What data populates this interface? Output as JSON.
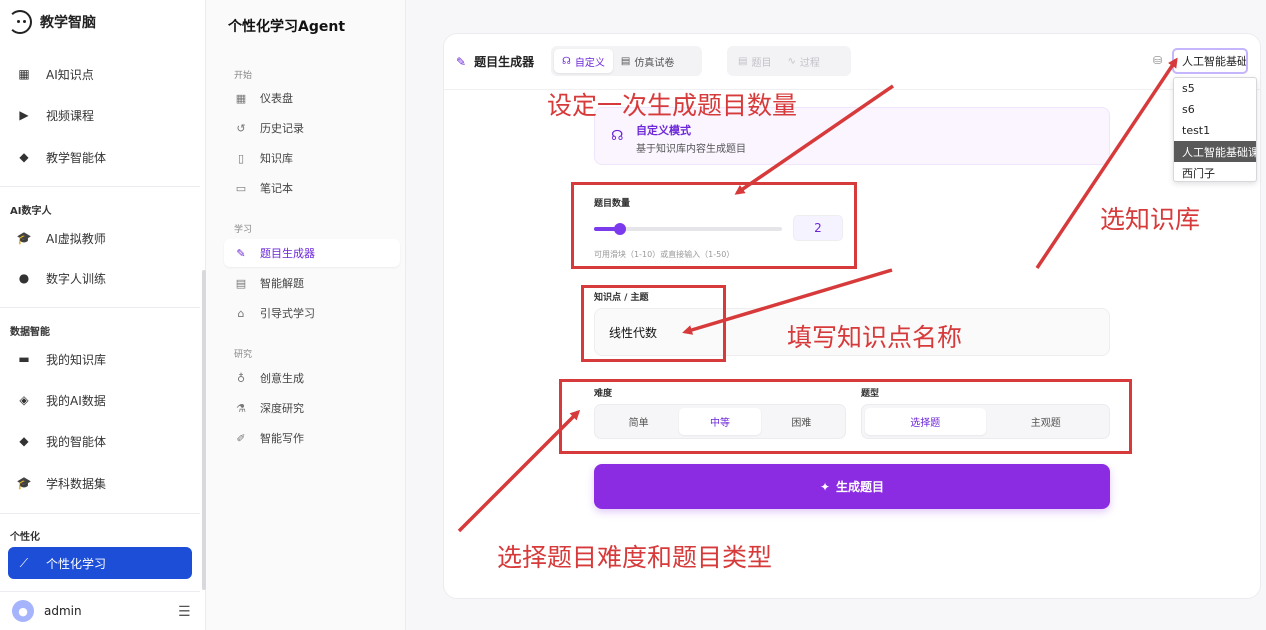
{
  "app": {
    "name": "教学智脑"
  },
  "sidebar": {
    "items_top": [
      {
        "label": "AI知识点",
        "icon": "film-icon"
      },
      {
        "label": "视频课程",
        "icon": "play-icon"
      },
      {
        "label": "教学智能体",
        "icon": "cube-icon"
      }
    ],
    "section_digital": "AI数字人",
    "items_digital": [
      {
        "label": "AI虚拟教师",
        "icon": "graduation-cap-icon"
      },
      {
        "label": "数字人训练",
        "icon": "person-icon"
      }
    ],
    "section_data": "数据智能",
    "items_data": [
      {
        "label": "我的知识库",
        "icon": "book-icon"
      },
      {
        "label": "我的AI数据",
        "icon": "box-icon"
      },
      {
        "label": "我的智能体",
        "icon": "cube-icon"
      },
      {
        "label": "学科数据集",
        "icon": "graduation-cap-icon"
      }
    ],
    "section_personal": "个性化",
    "active_item": {
      "label": "个性化学习",
      "icon": "wand-icon"
    },
    "user": "admin"
  },
  "panel2": {
    "title": "个性化学习Agent",
    "section_start": "开始",
    "items_start": [
      "仪表盘",
      "历史记录",
      "知识库",
      "笔记本"
    ],
    "section_learn": "学习",
    "items_learn": [
      "题目生成器",
      "智能解题",
      "引导式学习"
    ],
    "section_research": "研究",
    "items_research": [
      "创意生成",
      "深度研究",
      "智能写作"
    ]
  },
  "header": {
    "title": "题目生成器",
    "tab_custom": "自定义",
    "tab_mock": "仿真试卷",
    "tab_questions": "题目",
    "tab_process": "过程"
  },
  "kb_select": {
    "value": "人工智能基础课",
    "options": [
      "s5",
      "s6",
      "test1",
      "人工智能基础课",
      "西门子"
    ]
  },
  "mode": {
    "title": "自定义模式",
    "desc": "基于知识库内容生成题目"
  },
  "count": {
    "label": "题目数量",
    "value": "2",
    "fraction": 0.111,
    "hint": "可用滑块（1-10）或直接输入（1-50）"
  },
  "topic": {
    "label": "知识点 / 主题",
    "value": "线性代数"
  },
  "difficulty": {
    "label": "难度",
    "options": [
      "简单",
      "中等",
      "困难"
    ],
    "selected": "中等"
  },
  "qtype": {
    "label": "题型",
    "options": [
      "选择题",
      "主观题"
    ],
    "selected": "选择题"
  },
  "generate_button": "生成题目",
  "annotations": {
    "count": "设定一次生成题目数量",
    "kb": "选知识库",
    "topic": "填写知识点名称",
    "diff": "选择题目难度和题目类型",
    "color": "#d73a3a"
  }
}
